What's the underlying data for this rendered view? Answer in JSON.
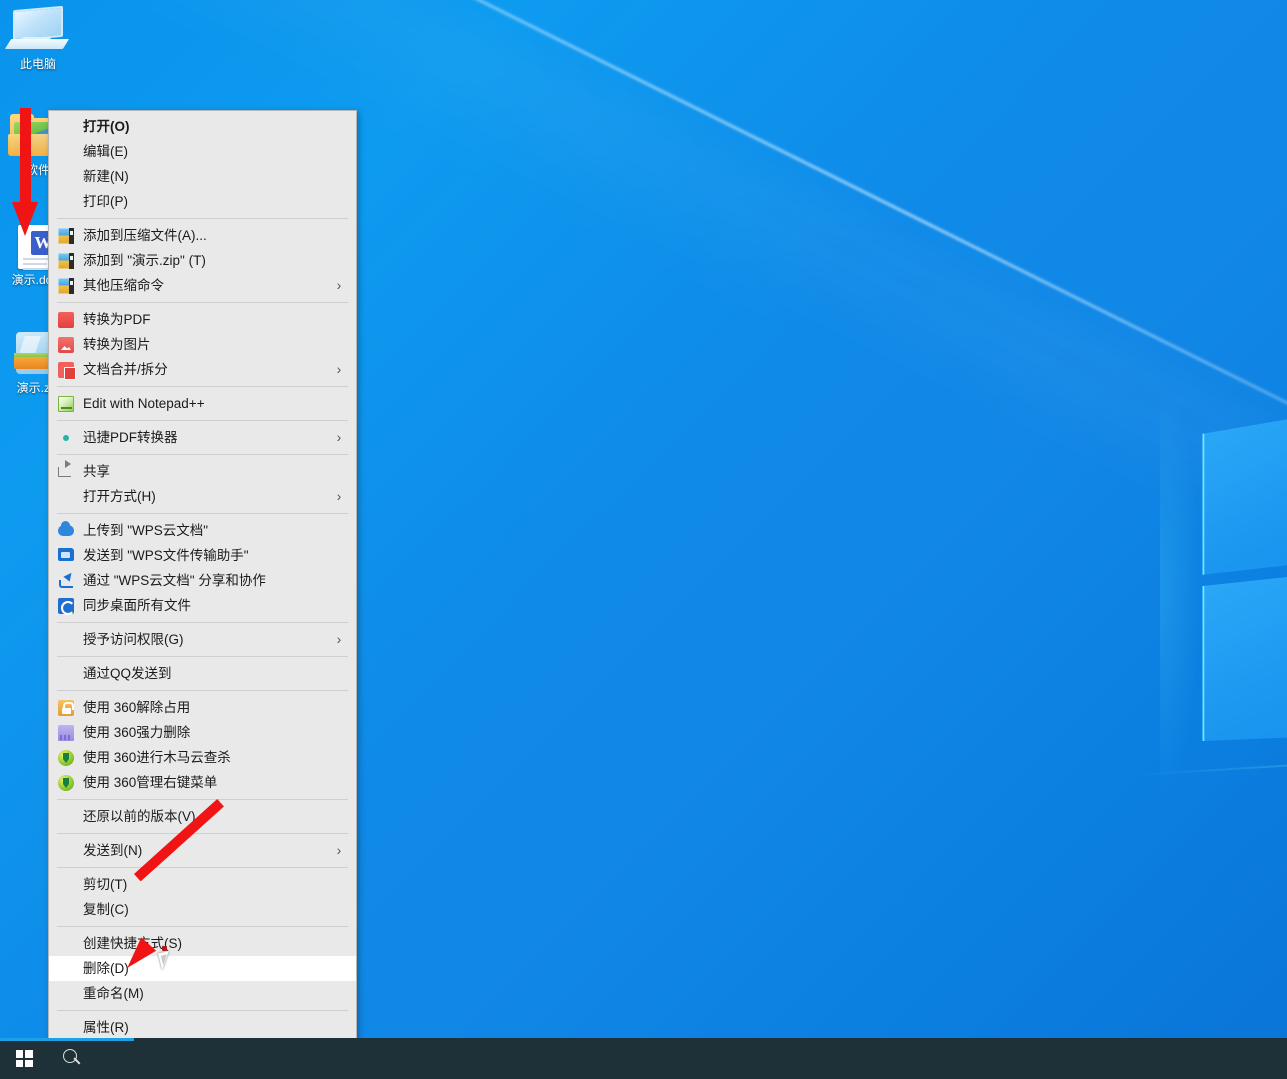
{
  "desktop": {
    "icons": [
      {
        "name": "this-pc",
        "label": "此电脑",
        "glyph": "monitor-icon"
      },
      {
        "name": "software-folder",
        "label": "软件",
        "glyph": "folder-icon"
      },
      {
        "name": "demo-docx",
        "label": "演示.docx",
        "glyph": "word-document-icon"
      },
      {
        "name": "demo-zip",
        "label": "演示.zip",
        "glyph": "zip-archive-icon"
      }
    ]
  },
  "context_menu": {
    "selected_item": "删除(D)",
    "groups": [
      {
        "items": [
          {
            "label": "打开(O)",
            "icon": "",
            "bold": true,
            "arrow": false
          },
          {
            "label": "编辑(E)",
            "icon": "",
            "bold": false,
            "arrow": false
          },
          {
            "label": "新建(N)",
            "icon": "",
            "bold": false,
            "arrow": false
          },
          {
            "label": "打印(P)",
            "icon": "",
            "bold": false,
            "arrow": false
          }
        ]
      },
      {
        "items": [
          {
            "label": "添加到压缩文件(A)...",
            "icon": "winrar-icon",
            "bold": false,
            "arrow": false
          },
          {
            "label": "添加到 \"演示.zip\" (T)",
            "icon": "winrar-icon",
            "bold": false,
            "arrow": false
          },
          {
            "label": "其他压缩命令",
            "icon": "winrar-icon",
            "bold": false,
            "arrow": true
          }
        ]
      },
      {
        "items": [
          {
            "label": "转换为PDF",
            "icon": "pdf-convert-icon",
            "bold": false,
            "arrow": false
          },
          {
            "label": "转换为图片",
            "icon": "image-convert-icon",
            "bold": false,
            "arrow": false
          },
          {
            "label": "文档合并/拆分",
            "icon": "pdf-split-icon",
            "bold": false,
            "arrow": true
          }
        ]
      },
      {
        "items": [
          {
            "label": "Edit with Notepad++",
            "icon": "notepadpp-icon",
            "bold": false,
            "arrow": false
          }
        ]
      },
      {
        "items": [
          {
            "label": "迅捷PDF转换器",
            "icon": "xunjie-pdf-icon",
            "bold": false,
            "arrow": true
          }
        ]
      },
      {
        "items": [
          {
            "label": "共享",
            "icon": "share-icon",
            "bold": false,
            "arrow": false
          },
          {
            "label": "打开方式(H)",
            "icon": "",
            "bold": false,
            "arrow": true
          }
        ]
      },
      {
        "items": [
          {
            "label": "上传到 \"WPS云文档\"",
            "icon": "cloud-upload-icon",
            "bold": false,
            "arrow": false
          },
          {
            "label": "发送到 \"WPS文件传输助手\"",
            "icon": "blue-folder-icon",
            "bold": false,
            "arrow": false
          },
          {
            "label": "通过 \"WPS云文档\" 分享和协作",
            "icon": "share-arrow-icon",
            "bold": false,
            "arrow": false
          },
          {
            "label": "同步桌面所有文件",
            "icon": "sync-icon",
            "bold": false,
            "arrow": false
          }
        ]
      },
      {
        "items": [
          {
            "label": "授予访问权限(G)",
            "icon": "",
            "bold": false,
            "arrow": true
          }
        ]
      },
      {
        "items": [
          {
            "label": "通过QQ发送到",
            "icon": "",
            "bold": false,
            "arrow": false
          }
        ]
      },
      {
        "items": [
          {
            "label": "使用 360解除占用",
            "icon": "lock-360-icon",
            "bold": false,
            "arrow": false
          },
          {
            "label": "使用 360强力删除",
            "icon": "shredder-360-icon",
            "bold": false,
            "arrow": false
          },
          {
            "label": "使用 360进行木马云查杀",
            "icon": "shield-360-icon",
            "bold": false,
            "arrow": false
          },
          {
            "label": "使用 360管理右键菜单",
            "icon": "shield-360-icon",
            "bold": false,
            "arrow": false
          }
        ]
      },
      {
        "items": [
          {
            "label": "还原以前的版本(V)",
            "icon": "",
            "bold": false,
            "arrow": false
          }
        ]
      },
      {
        "items": [
          {
            "label": "发送到(N)",
            "icon": "",
            "bold": false,
            "arrow": true
          }
        ]
      },
      {
        "items": [
          {
            "label": "剪切(T)",
            "icon": "",
            "bold": false,
            "arrow": false
          },
          {
            "label": "复制(C)",
            "icon": "",
            "bold": false,
            "arrow": false
          }
        ]
      },
      {
        "items": [
          {
            "label": "创建快捷方式(S)",
            "icon": "",
            "bold": false,
            "arrow": false
          },
          {
            "label": "删除(D)",
            "icon": "",
            "bold": false,
            "arrow": false,
            "selected": true
          },
          {
            "label": "重命名(M)",
            "icon": "",
            "bold": false,
            "arrow": false
          }
        ]
      },
      {
        "items": [
          {
            "label": "属性(R)",
            "icon": "",
            "bold": false,
            "arrow": false
          }
        ]
      }
    ]
  },
  "taskbar": {
    "start_label": "开始",
    "search_label": "搜索"
  },
  "colors": {
    "desktop_blue": "#0d8ce8",
    "menu_bg": "#e9e9e9",
    "menu_border": "#b6b6b6",
    "selected_bg": "#ffffff",
    "taskbar_bg": "#1f3138",
    "annotation_red": "#f01414",
    "accent_blue": "#1ea0e6"
  }
}
